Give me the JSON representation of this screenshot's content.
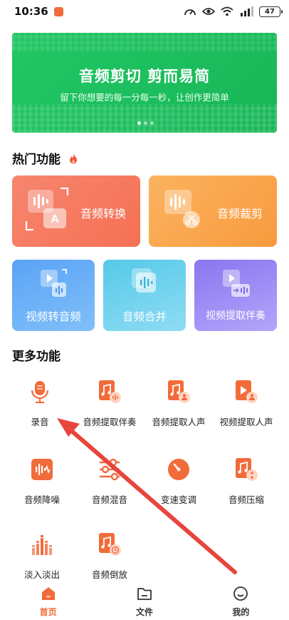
{
  "status_bar": {
    "time": "10:36",
    "battery": "47"
  },
  "banner": {
    "title": "音频剪切 剪而易简",
    "subtitle": "留下你想要的每一分每一秒，让创作更简单"
  },
  "hot": {
    "title": "热门功能",
    "cards": [
      {
        "label": "音频转换"
      },
      {
        "label": "音频裁剪"
      },
      {
        "label": "视频转音频"
      },
      {
        "label": "音频合并"
      },
      {
        "label": "视频提取伴奏"
      }
    ]
  },
  "more": {
    "title": "更多功能",
    "tools": [
      {
        "label": "录音"
      },
      {
        "label": "音频提取伴奏"
      },
      {
        "label": "音频提取人声"
      },
      {
        "label": "视频提取人声"
      },
      {
        "label": "音频降噪"
      },
      {
        "label": "音频混音"
      },
      {
        "label": "变速变调"
      },
      {
        "label": "音频压缩"
      },
      {
        "label": "淡入淡出"
      },
      {
        "label": "音频倒放"
      }
    ]
  },
  "tabs": [
    {
      "label": "首页",
      "active": true
    },
    {
      "label": "文件",
      "active": false
    },
    {
      "label": "我的",
      "active": false
    }
  ],
  "colors": {
    "accent": "#f26b3a",
    "banner": "#1fc160",
    "arrow": "#e8453c"
  }
}
